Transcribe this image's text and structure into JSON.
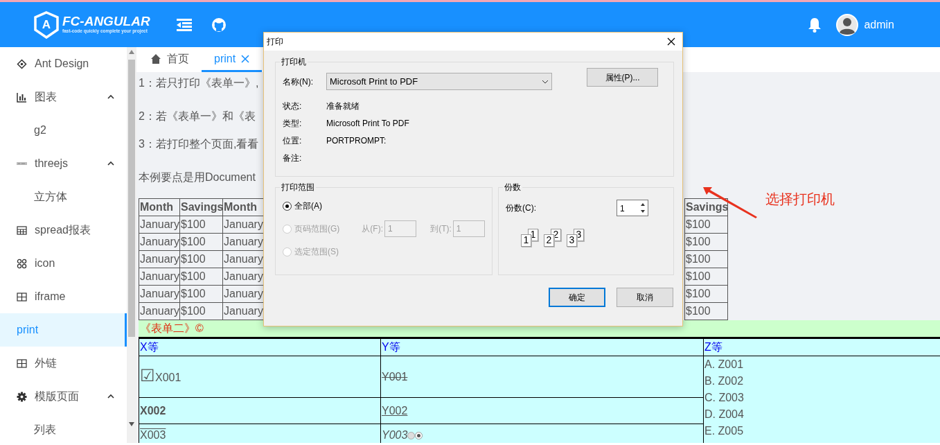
{
  "header": {
    "logo_letter": "A",
    "logo_title": "FC-ANGULAR",
    "logo_subtitle": "fast-code quickly complete your project",
    "user": "admin"
  },
  "sidebar": {
    "items": [
      {
        "label": "Ant Design",
        "selected": false
      },
      {
        "label": "图表",
        "selected": false,
        "expanded": true,
        "children": [
          {
            "label": "g2",
            "selected": false
          }
        ]
      },
      {
        "label": "threejs",
        "selected": false,
        "expanded": true,
        "children": [
          {
            "label": "立方体",
            "selected": false
          }
        ]
      },
      {
        "label": "spread报表",
        "selected": false
      },
      {
        "label": "icon",
        "selected": false
      },
      {
        "label": "iframe",
        "selected": false
      },
      {
        "label": "print",
        "selected": true
      },
      {
        "label": "外链",
        "selected": false
      },
      {
        "label": "模版页面",
        "selected": false,
        "expanded": true,
        "children": [
          {
            "label": "列表",
            "selected": false
          }
        ]
      }
    ]
  },
  "tabs": [
    {
      "label": "首页",
      "selected": false
    },
    {
      "label": "print",
      "selected": true
    }
  ],
  "notes": [
    "1：若只打印《表单一》,",
    "2：若《表单一》和《表",
    "3：若打印整个页面,看看",
    "本例要点是用Document"
  ],
  "table1": {
    "left_columns": [
      "Month",
      "Savings",
      "Month"
    ],
    "right_column": "Savings",
    "rows": [
      {
        "left": [
          "January",
          "$100",
          "January"
        ],
        "right": "$100"
      },
      {
        "left": [
          "January",
          "$100",
          "January"
        ],
        "right": "$100"
      },
      {
        "left": [
          "January",
          "$100",
          "January"
        ],
        "right": "$100"
      },
      {
        "left": [
          "January",
          "$100",
          "January"
        ],
        "right": "$100"
      },
      {
        "left": [
          "January",
          "$100",
          "January"
        ],
        "right": "$100"
      },
      {
        "left": [
          "January",
          "$100",
          "January"
        ],
        "right": "$100"
      }
    ]
  },
  "form2": {
    "title": "《表单二》©",
    "columns": [
      "X等",
      "Y等",
      "Z等"
    ],
    "rows": [
      {
        "x": {
          "mark": "☑",
          "text": "X001"
        },
        "y": {
          "text": "Y001"
        }
      },
      {
        "x": {
          "text": "X002"
        },
        "y": {
          "text": "Y002"
        }
      },
      {
        "x": {
          "text": "X003"
        },
        "y": {
          "text": "Y003",
          "radios": [
            {
              "selected": false
            },
            {
              "selected": true
            }
          ]
        }
      }
    ],
    "z_list": [
      "A. Z001",
      "B. Z002",
      "C. Z003",
      "D. Z004",
      "E. Z005"
    ]
  },
  "dialog": {
    "title": "打印",
    "printer_group": "打印机",
    "name_label": "名称(N):",
    "printer": "Microsoft Print to PDF",
    "properties_button": "属性(P)...",
    "info": [
      {
        "label": "状态:",
        "value": "准备就绪"
      },
      {
        "label": "类型:",
        "value": "Microsoft Print To PDF"
      },
      {
        "label": "位置:",
        "value": "PORTPROMPT:"
      },
      {
        "label": "备注:"
      }
    ],
    "range_group": "打印范围",
    "range_options": [
      {
        "label": "全部(A)",
        "selected": true,
        "disabled": false
      },
      {
        "label": "页码范围(G)",
        "selected": false,
        "disabled": true
      },
      {
        "label": "选定范围(S)",
        "selected": false,
        "disabled": true
      }
    ],
    "from_label": "从(F):",
    "from_value": "1",
    "to_label": "到(T):",
    "to_value": "1",
    "fields_disabled": true,
    "copies_group": "份数",
    "copies_label": "份数(C):",
    "copies_value": "1",
    "collate_pages": [
      [
        "1",
        "1"
      ],
      [
        "2",
        "2"
      ],
      [
        "3",
        "3"
      ]
    ],
    "buttons": [
      {
        "label": "确定",
        "default": true
      },
      {
        "label": "取消",
        "default": false
      }
    ]
  },
  "annotation": {
    "text": "选择打印机"
  }
}
